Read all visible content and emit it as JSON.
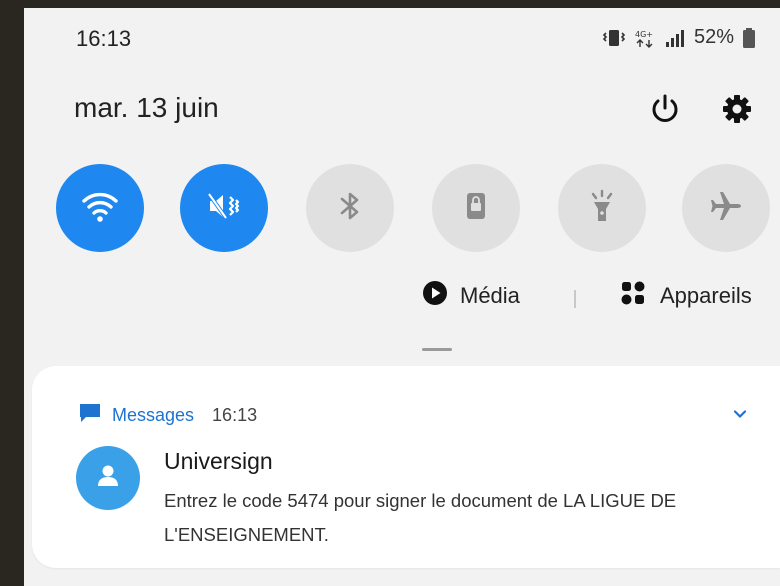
{
  "status_bar": {
    "time": "16:13",
    "battery": "52%",
    "icons": [
      "vibrate-icon",
      "mobile-data-icon",
      "signal-icon",
      "battery-icon"
    ]
  },
  "header": {
    "date": "mar. 13 juin",
    "icons": [
      "power-icon",
      "gear-icon"
    ]
  },
  "quick_toggles": [
    {
      "id": "wifi",
      "icon": "wifi-icon",
      "on": true
    },
    {
      "id": "sound",
      "icon": "vibrate-icon",
      "on": true
    },
    {
      "id": "bluetooth",
      "icon": "bluetooth-icon",
      "on": false
    },
    {
      "id": "orientation",
      "icon": "portrait-lock-icon",
      "on": false
    },
    {
      "id": "flashlight",
      "icon": "flashlight-icon",
      "on": false
    },
    {
      "id": "airplane",
      "icon": "airplane-icon",
      "on": false
    }
  ],
  "media_row": {
    "media_label": "Média",
    "devices_label": "Appareils"
  },
  "notification": {
    "app_name": "Messages",
    "time": "16:13",
    "sender": "Universign",
    "body": "Entrez le code 5474 pour signer le document de LA LIGUE DE L'ENSEIGNEMENT."
  },
  "colors": {
    "accent": "#1e88f0",
    "toggle_off": "#e0e0e0",
    "panel": "#f2f2f2",
    "app_name": "#1e73d0",
    "avatar": "#3aa0e8"
  }
}
